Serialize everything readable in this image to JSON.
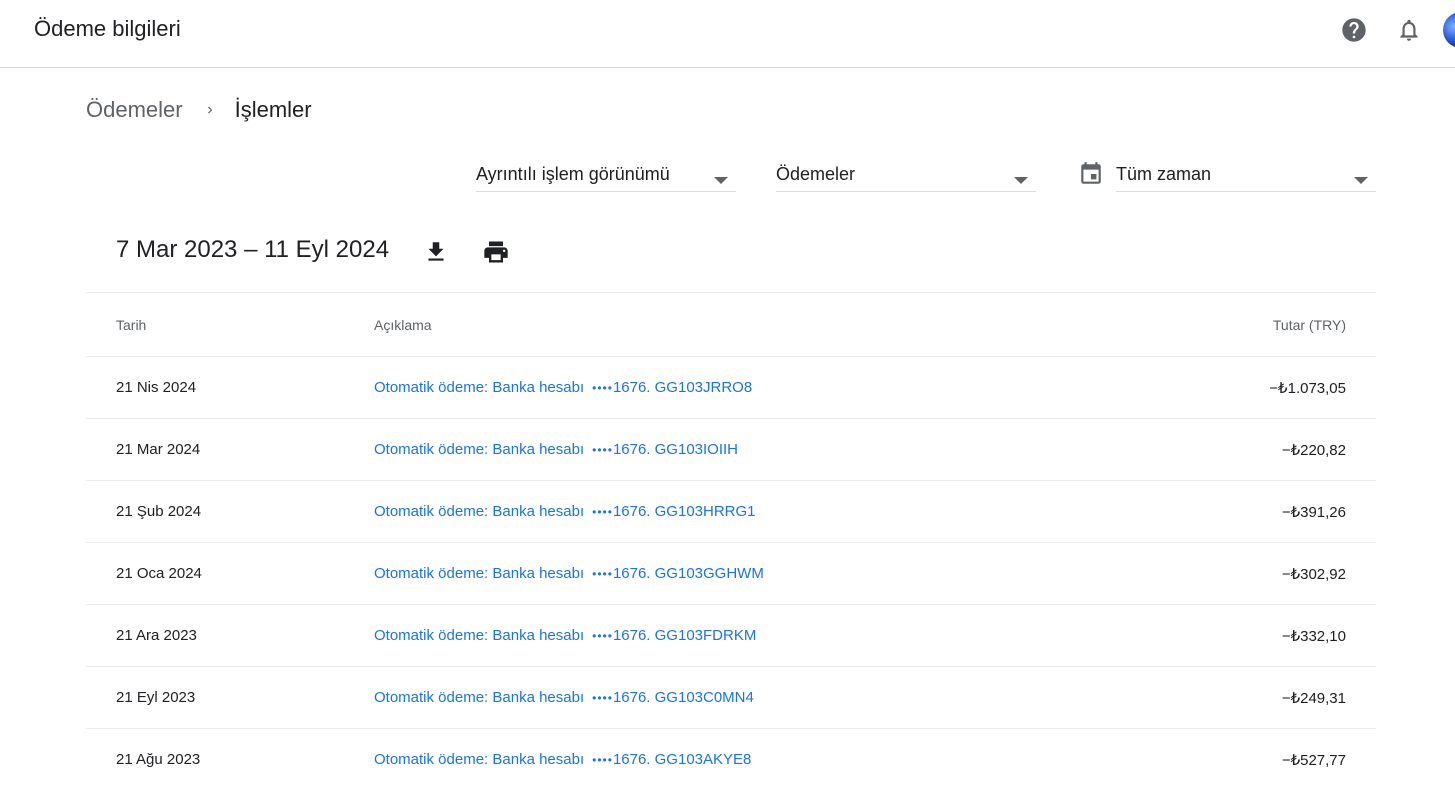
{
  "header": {
    "title": "Ödeme bilgileri",
    "icons": [
      "help-icon",
      "notifications-icon",
      "account-avatar"
    ]
  },
  "breadcrumb": {
    "parent": "Ödemeler",
    "current": "İşlemler"
  },
  "filters": {
    "view": "Ayrıntılı işlem görünümü",
    "type": "Ödemeler",
    "period": "Tüm zaman"
  },
  "range": {
    "label": "7 Mar 2023 – 11 Eyl 2024"
  },
  "table": {
    "columns": [
      "Tarih",
      "Açıklama",
      "Tutar (TRY)"
    ],
    "rows": [
      {
        "date": "21 Nis 2024",
        "desc": "Otomatik ödeme: Banka hesabı",
        "dots": "••••",
        "ref": "1676. GG103JRRO8",
        "amount": "−₺1.073,05"
      },
      {
        "date": "21 Mar 2024",
        "desc": "Otomatik ödeme: Banka hesabı",
        "dots": "••••",
        "ref": "1676. GG103IOIIH",
        "amount": "−₺220,82"
      },
      {
        "date": "21 Şub 2024",
        "desc": "Otomatik ödeme: Banka hesabı",
        "dots": "••••",
        "ref": "1676. GG103HRRG1",
        "amount": "−₺391,26"
      },
      {
        "date": "21 Oca 2024",
        "desc": "Otomatik ödeme: Banka hesabı",
        "dots": "••••",
        "ref": "1676. GG103GGHWM",
        "amount": "−₺302,92"
      },
      {
        "date": "21 Ara 2023",
        "desc": "Otomatik ödeme: Banka hesabı",
        "dots": "••••",
        "ref": "1676. GG103FDRKM",
        "amount": "−₺332,10"
      },
      {
        "date": "21 Eyl 2023",
        "desc": "Otomatik ödeme: Banka hesabı",
        "dots": "••••",
        "ref": "1676. GG103C0MN4",
        "amount": "−₺249,31"
      },
      {
        "date": "21 Ağu 2023",
        "desc": "Otomatik ödeme: Banka hesabı",
        "dots": "••••",
        "ref": "1676. GG103AKYE8",
        "amount": "−₺527,77"
      }
    ]
  },
  "colors": {
    "link": "#1a73e8",
    "divider": "#e8eaed",
    "icon": "#5f6368"
  }
}
